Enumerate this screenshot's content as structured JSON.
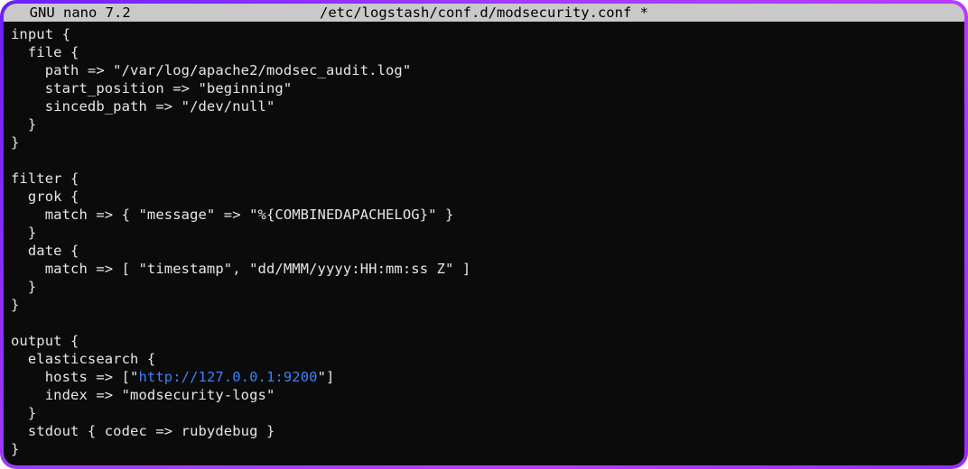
{
  "titlebar": {
    "app": "  GNU nano 7.2",
    "file": "/etc/logstash/conf.d/modsecurity.conf *"
  },
  "editor": {
    "lines": [
      "input {",
      "  file {",
      "    path => \"/var/log/apache2/modsec_audit.log\"",
      "    start_position => \"beginning\"",
      "    sincedb_path => \"/dev/null\"",
      "  }",
      "}",
      "",
      "filter {",
      "  grok {",
      "    match => { \"message\" => \"%{COMBINEDAPACHELOG}\" }",
      "  }",
      "  date {",
      "    match => [ \"timestamp\", \"dd/MMM/yyyy:HH:mm:ss Z\" ]",
      "  }",
      "}",
      "",
      "output {",
      "  elasticsearch {"
    ],
    "hosts_prefix": "    hosts => [\"",
    "hosts_url": "http://127.0.0.1:9200",
    "hosts_suffix": "\"]",
    "lines_after": [
      "    index => \"modsecurity-logs\"",
      "  }",
      "  stdout { codec => rubydebug }",
      "}"
    ]
  }
}
